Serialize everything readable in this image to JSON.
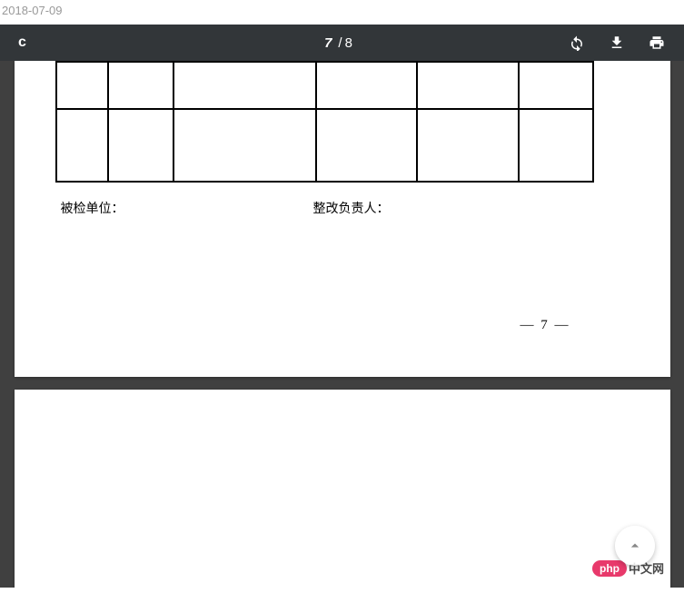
{
  "header": {
    "date": "2018-07-09"
  },
  "toolbar": {
    "doc_label": "c",
    "page_current": "7",
    "page_total": "8"
  },
  "doc": {
    "label_inspected_unit": "被检单位：",
    "label_responsible_person": "整改负责人：",
    "page_number_display": "— 7 —"
  },
  "watermark": {
    "logo_text": "php",
    "brand_text": "中文网"
  }
}
